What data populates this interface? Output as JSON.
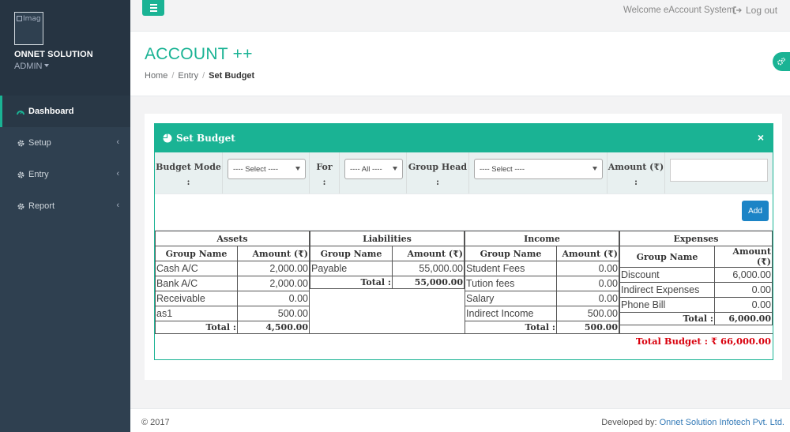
{
  "sidebar": {
    "avatar_alt": "Imag",
    "org_name": "ONNET SOLUTION",
    "role": "ADMIN",
    "items": [
      {
        "label": "Dashboard",
        "icon": "dashboard-icon",
        "active": true
      },
      {
        "label": "Setup",
        "icon": "gear-icon"
      },
      {
        "label": "Entry",
        "icon": "gear-icon"
      },
      {
        "label": "Report",
        "icon": "gear-icon"
      }
    ]
  },
  "topbar": {
    "welcome": "Welcome eAccount System",
    "logout": "Log out"
  },
  "heading": {
    "title": "ACCOUNT ++",
    "breadcrumb": [
      "Home",
      "Entry",
      "Set Budget"
    ]
  },
  "panel": {
    "title": "Set Budget",
    "close": "×",
    "form": {
      "budget_mode_label": "Budget Mode",
      "budget_mode_value": "---- Select ----",
      "for_label": "For",
      "for_value": "---- All ----",
      "group_head_label": "Group Head",
      "group_head_value": "---- Select ----",
      "amount_label": "Amount (₹)",
      "amount_value": "",
      "colon": ":",
      "add_label": "Add"
    }
  },
  "budget": {
    "group_name_header": "Group Name",
    "amount_header": "Amount (₹)",
    "total_label": "Total :",
    "sections": [
      {
        "title": "Assets",
        "rows": [
          {
            "name": "Cash A/C",
            "amount": "2,000.00"
          },
          {
            "name": "Bank A/C",
            "amount": "2,000.00"
          },
          {
            "name": "Receivable",
            "amount": "0.00"
          },
          {
            "name": "as1",
            "amount": "500.00"
          }
        ],
        "total": "4,500.00"
      },
      {
        "title": "Liabilities",
        "rows": [
          {
            "name": "Payable",
            "amount": "55,000.00"
          }
        ],
        "total": "55,000.00"
      },
      {
        "title": "Income",
        "rows": [
          {
            "name": "Student Fees",
            "amount": "0.00"
          },
          {
            "name": "Tution fees",
            "amount": "0.00"
          },
          {
            "name": "Salary",
            "amount": "0.00"
          },
          {
            "name": "Indirect Income",
            "amount": "500.00"
          }
        ],
        "total": "500.00"
      },
      {
        "title": "Expenses",
        "rows": [
          {
            "name": "Discount",
            "amount": "6,000.00"
          },
          {
            "name": "Indirect Expenses",
            "amount": "0.00"
          },
          {
            "name": "Phone Bill",
            "amount": "0.00"
          }
        ],
        "total": "6,000.00"
      }
    ],
    "grand_total": "Total Budget : ₹ 66,000.00"
  },
  "footer": {
    "copyright": "© 2017",
    "developed_by": "Developed by: ",
    "company": "Onnet Solution Infotech Pvt. Ltd."
  },
  "colors": {
    "accent": "#1ab394",
    "sidebar": "#2f4050",
    "button": "#1c84c6",
    "total_budget": "#d9000d"
  }
}
